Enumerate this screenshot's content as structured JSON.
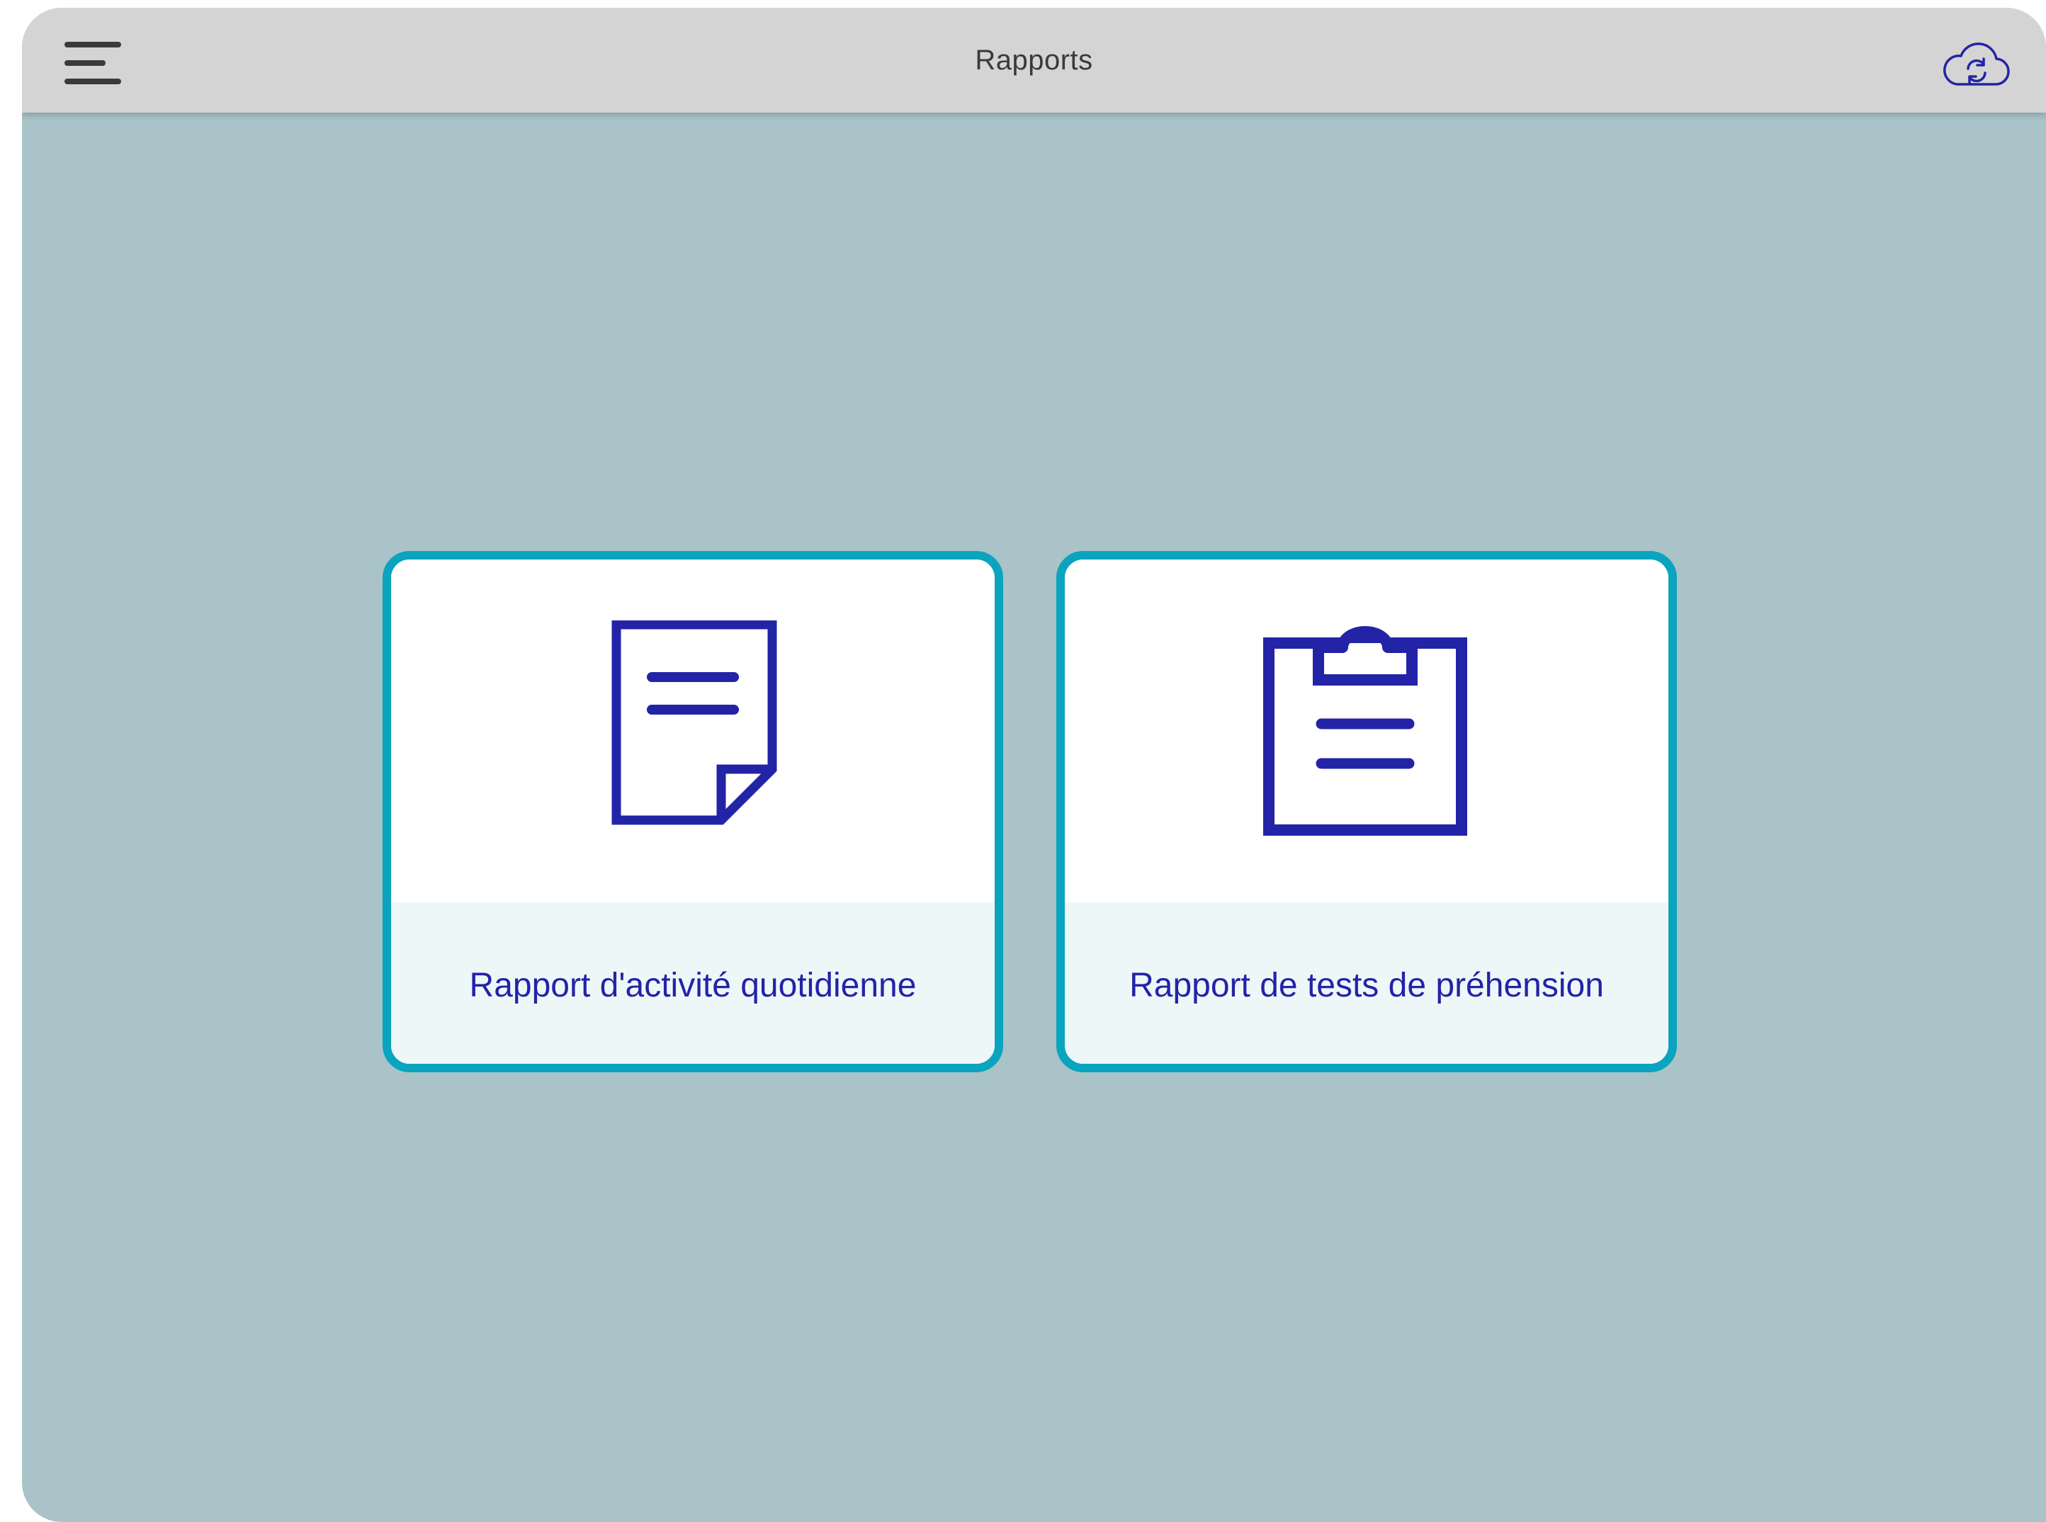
{
  "header": {
    "title": "Rapports",
    "menu_icon": "hamburger-menu-icon",
    "sync_icon": "cloud-sync-icon"
  },
  "reports": [
    {
      "label": "Rapport d'activité quotidienne",
      "icon": "document-icon"
    },
    {
      "label": "Rapport de tests de préhension",
      "icon": "clipboard-icon"
    }
  ],
  "colors": {
    "background": "#a9c3c8",
    "top_bar": "#d4d4d4",
    "card_border": "#0aa4bf",
    "accent": "#2323a8",
    "card_label_bg": "#eef7f8"
  }
}
